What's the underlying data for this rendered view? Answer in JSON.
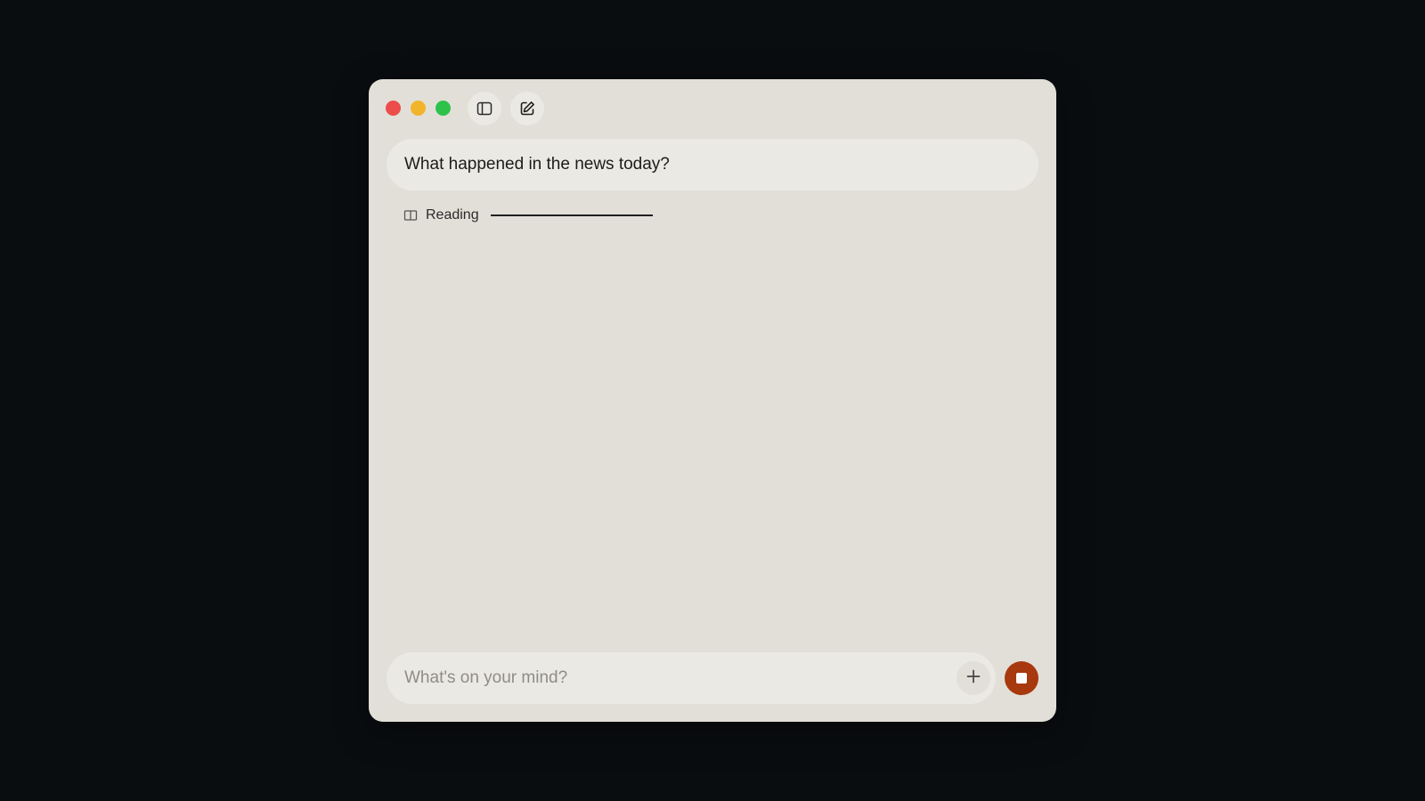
{
  "colors": {
    "close": "#ec4d4b",
    "minimize": "#f2b42a",
    "maximize": "#2ec24a",
    "accent": "#a8380e"
  },
  "toolbar": {
    "sidebar_icon": "sidebar-toggle-icon",
    "compose_icon": "compose-icon"
  },
  "conversation": {
    "user_message": "What happened in the news today?",
    "status": {
      "icon": "book-icon",
      "label": "Reading",
      "progress": 1.0
    }
  },
  "composer": {
    "placeholder": "What's on your mind?",
    "value": "",
    "add_icon": "plus-icon",
    "stop_icon": "stop-icon"
  }
}
